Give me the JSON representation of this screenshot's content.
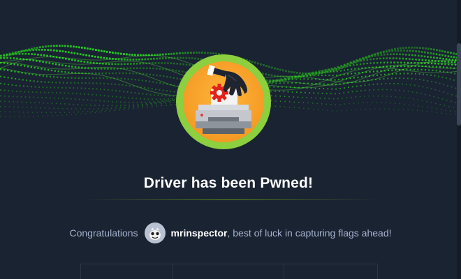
{
  "modal": {
    "title": "Driver has been Pwned!",
    "congrats_prefix": "Congratulations",
    "username": "mrinspector",
    "congrats_suffix": ", best of luck in capturing flags ahead!"
  },
  "machine": {
    "icon": "printer-icon"
  },
  "colors": {
    "background": "#1a2332",
    "accent_green": "#9fef00",
    "ring_green": "#8ccf3f",
    "avatar_orange": "#f59b26",
    "text_muted": "#a4b1cd"
  }
}
